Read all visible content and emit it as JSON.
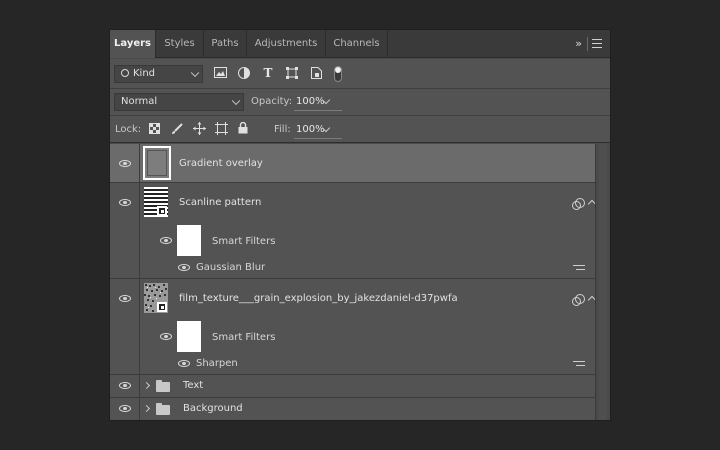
{
  "tabs": [
    {
      "label": "Layers",
      "active": true
    },
    {
      "label": "Styles",
      "active": false
    },
    {
      "label": "Paths",
      "active": false
    },
    {
      "label": "Adjustments",
      "active": false
    },
    {
      "label": "Channels",
      "active": false
    }
  ],
  "tabbar": {
    "collapse_icon": "double-chevron-right-icon",
    "menu_icon": "hamburger-menu-icon",
    "collapse_glyph": "»"
  },
  "filter": {
    "kind_label": "Kind",
    "search_icon": "search-icon",
    "icons": [
      "image-filter-icon",
      "adjustment-filter-icon",
      "type-filter-icon",
      "shape-filter-icon",
      "smart-object-filter-icon",
      "filter-toggle-icon"
    ]
  },
  "blend": {
    "mode": "Normal",
    "opacity_label": "Opacity:",
    "opacity_value": "100%"
  },
  "lock": {
    "label": "Lock:",
    "icons": [
      "lock-transparent-pixels-icon",
      "lock-image-pixels-icon",
      "lock-position-icon",
      "lock-artboard-icon",
      "lock-all-icon"
    ],
    "fill_label": "Fill:",
    "fill_value": "100%"
  },
  "layers": [
    {
      "name": "Gradient overlay",
      "selected": true
    },
    {
      "name": "Scanline pattern",
      "smart_filters_label": "Smart Filters",
      "filter_name": "Gaussian Blur"
    },
    {
      "name": "film_texture___grain_explosion_by_jakezdaniel-d37pwfa",
      "smart_filters_label": "Smart Filters",
      "filter_name": "Sharpen"
    },
    {
      "name": "Text",
      "type": "group"
    },
    {
      "name": "Background",
      "type": "group"
    }
  ],
  "colors": {
    "panel_bg": "#535353",
    "selected_row": "#6b6b6b",
    "app_bg": "#262626"
  }
}
